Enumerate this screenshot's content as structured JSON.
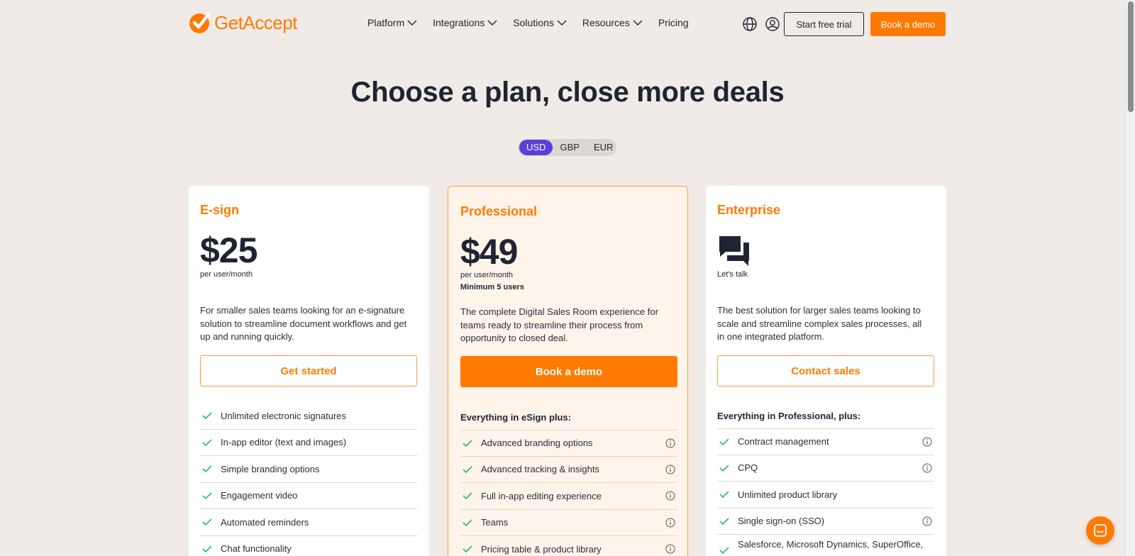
{
  "header": {
    "logo_text_get": "Get",
    "logo_text_accept": "Accept",
    "nav": [
      {
        "label": "Platform",
        "has_dropdown": true
      },
      {
        "label": "Integrations",
        "has_dropdown": true
      },
      {
        "label": "Solutions",
        "has_dropdown": true
      },
      {
        "label": "Resources",
        "has_dropdown": true
      },
      {
        "label": "Pricing",
        "has_dropdown": false
      }
    ],
    "trial_label": "Start free trial",
    "demo_label": "Book a demo"
  },
  "hero": {
    "title": "Choose a plan, close more deals",
    "currencies": [
      "USD",
      "GBP",
      "EUR"
    ],
    "selected_currency": "USD"
  },
  "plans": {
    "esign": {
      "name": "E-sign",
      "price": "$25",
      "price_sub": "per user/month",
      "description": "For smaller sales teams looking for an e-signature solution to streamline document workflows and get up and running quickly.",
      "cta": "Get started",
      "features": [
        "Unlimited electronic signatures",
        "In-app editor (text and images)",
        "Simple branding options",
        "Engagement video",
        "Automated reminders",
        "Chat functionality"
      ]
    },
    "professional": {
      "name": "Professional",
      "price": "$49",
      "price_sub": "per user/month",
      "min_users": "Minimum 5 users",
      "description": "The complete Digital Sales Room experience for teams ready to streamline their process from opportunity to closed deal.",
      "cta": "Book a demo",
      "features_heading": "Everything in eSign plus:",
      "features": [
        "Advanced branding options",
        "Advanced tracking & insights",
        "Full in-app editing experience",
        "Teams",
        "Pricing table & product library"
      ]
    },
    "enterprise": {
      "name": "Enterprise",
      "price_sub": "Let's talk",
      "description": "The best solution for larger sales teams looking to scale and streamline complex sales processes, all in one integrated platform.",
      "cta": "Contact sales",
      "features_heading": "Everything in Professional, plus:",
      "features": [
        {
          "label": "Contract management",
          "info": true
        },
        {
          "label": "CPQ",
          "info": true
        },
        {
          "label": "Unlimited product library",
          "info": false
        },
        {
          "label": "Single sign-on (SSO)",
          "info": true
        },
        {
          "label": "Salesforce, Microsoft Dynamics, SuperOffice,",
          "info": false
        }
      ]
    }
  },
  "colors": {
    "brand_orange": "#ff7a00",
    "currency_active": "#5b3fd6",
    "check_green": "#2bb673",
    "page_bg": "#f0ebe6"
  },
  "icons": [
    "globe-icon",
    "user-icon",
    "chevron-down-icon",
    "check-icon",
    "info-icon",
    "chat-bubbles-icon",
    "messenger-icon"
  ]
}
